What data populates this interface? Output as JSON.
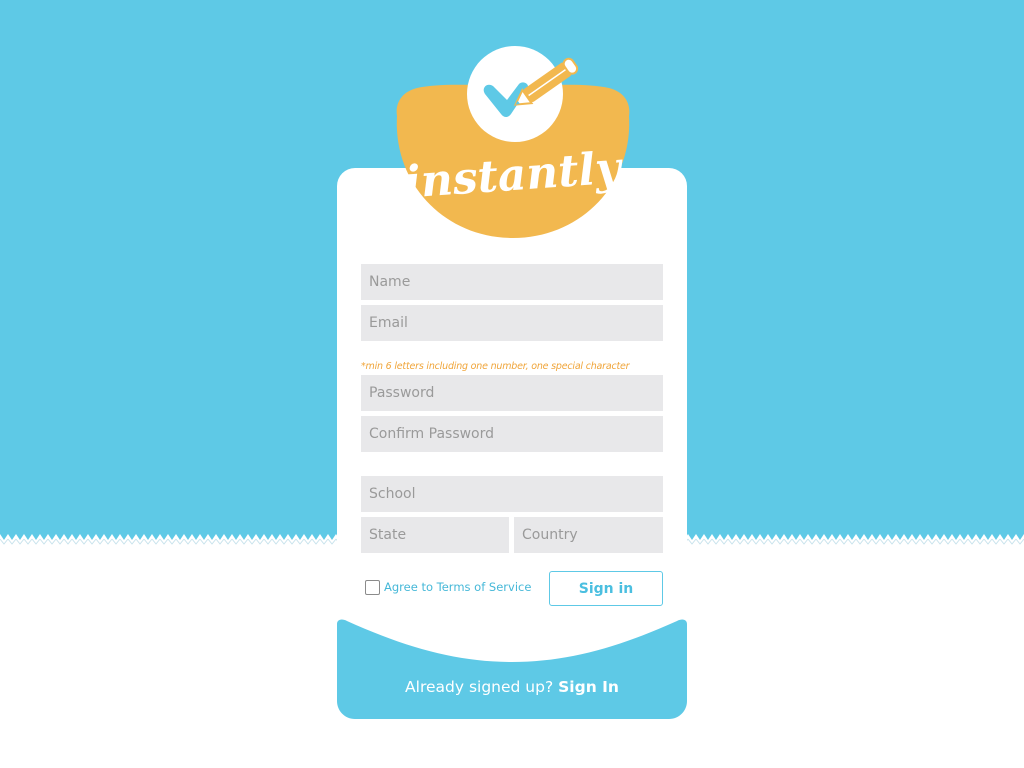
{
  "app": {
    "logo_text": "instantly"
  },
  "form": {
    "name_placeholder": "Name",
    "email_placeholder": "Email",
    "password_hint": "*min 6 letters including one number, one special character",
    "password_placeholder": "Password",
    "confirm_password_placeholder": "Confirm Password",
    "school_placeholder": "School",
    "state_placeholder": "State",
    "country_placeholder": "Country",
    "tos_label": "Agree to Terms of Service",
    "tos_checked": false,
    "signin_button_label": "Sign in"
  },
  "footer": {
    "prompt": "Already signed up?",
    "link_label": "Sign In"
  },
  "colors": {
    "background_blue": "#5ec9e6",
    "logo_orange": "#f2b84f",
    "hint_orange": "#f0a53a",
    "field_gray": "#e8e8ea",
    "link_blue": "#46b8d8"
  }
}
